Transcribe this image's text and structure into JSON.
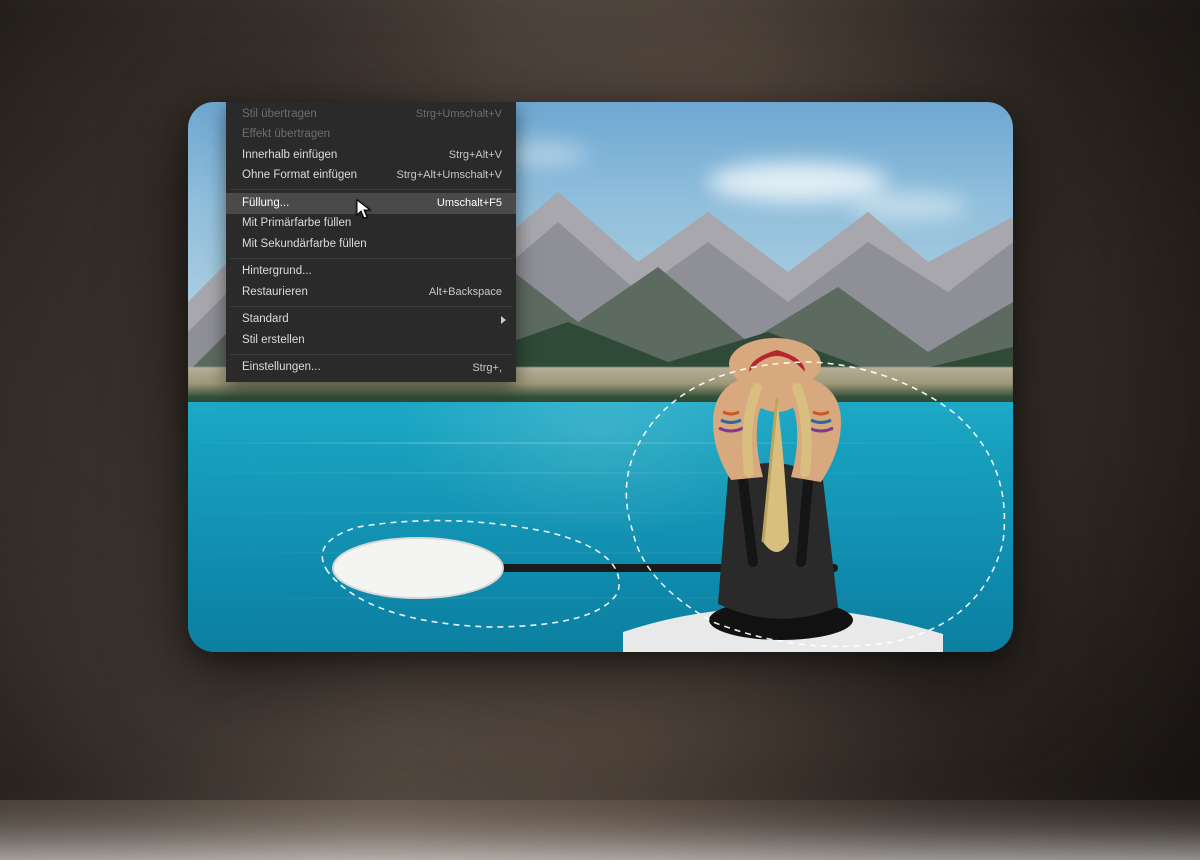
{
  "menu": {
    "items": [
      {
        "label": "Stil übertragen",
        "shortcut": "Strg+Umschalt+V",
        "disabled": true
      },
      {
        "label": "Effekt übertragen",
        "shortcut": "",
        "disabled": true
      },
      {
        "label": "Innerhalb einfügen",
        "shortcut": "Strg+Alt+V"
      },
      {
        "label": "Ohne Format einfügen",
        "shortcut": "Strg+Alt+Umschalt+V"
      }
    ],
    "items2": [
      {
        "label": "Füllung...",
        "shortcut": "Umschalt+F5",
        "highlighted": true
      },
      {
        "label": "Mit Primärfarbe füllen",
        "shortcut": ""
      },
      {
        "label": "Mit Sekundärfarbe füllen",
        "shortcut": ""
      }
    ],
    "items3": [
      {
        "label": "Hintergrund...",
        "shortcut": ""
      },
      {
        "label": "Restaurieren",
        "shortcut": "Alt+Backspace"
      }
    ],
    "items4": [
      {
        "label": "Standard",
        "shortcut": "",
        "submenu": true
      },
      {
        "label": "Stil erstellen",
        "shortcut": ""
      }
    ],
    "items5": [
      {
        "label": "Einstellungen...",
        "shortcut": "Strg+,"
      }
    ]
  },
  "scene": {
    "description": "Woman in kayak on turquoise lake, mountains in background, paddle resting, lasso selections around person and paddle"
  }
}
